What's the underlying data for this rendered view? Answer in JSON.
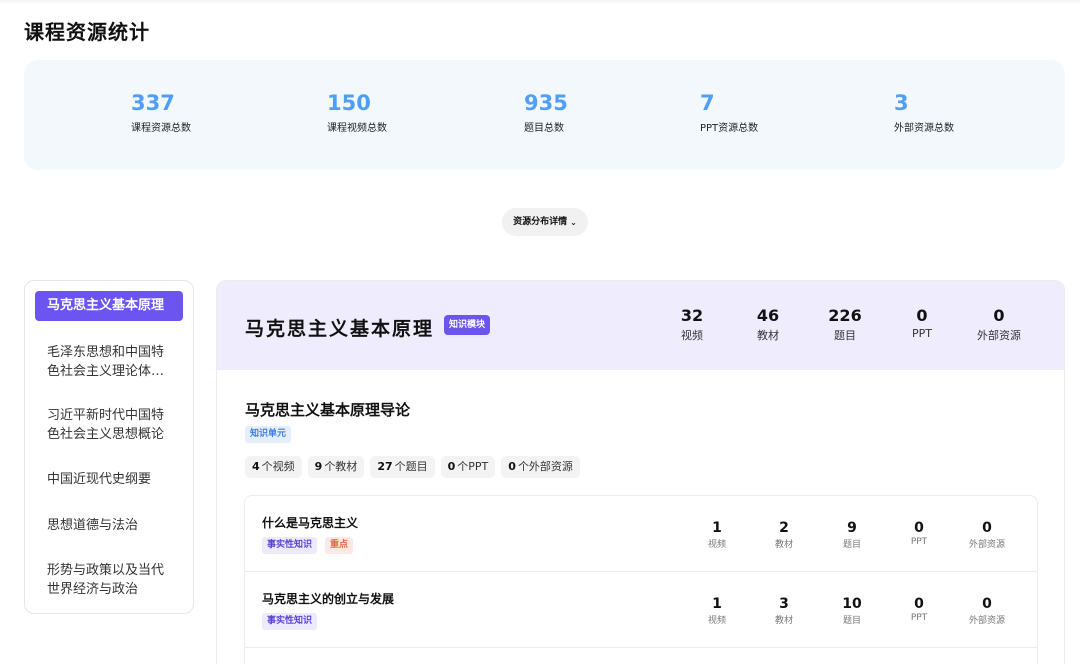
{
  "page_title": "课程资源统计",
  "summary_stats": [
    {
      "value": "337",
      "label": "课程资源总数"
    },
    {
      "value": "150",
      "label": "课程视频总数"
    },
    {
      "value": "935",
      "label": "题目总数"
    },
    {
      "value": "7",
      "label": "PPT资源总数"
    },
    {
      "value": "3",
      "label": "外部资源总数"
    }
  ],
  "dropdown": {
    "label": "资源分布详情",
    "chevron": "⌄"
  },
  "sidebar": {
    "items": [
      {
        "label": "马克思主义基本原理",
        "active": true
      },
      {
        "label": "毛泽东思想和中国特色社会主义理论体系概论"
      },
      {
        "label": "习近平新时代中国特色社会主义思想概论"
      },
      {
        "label": "中国近现代史纲要"
      },
      {
        "label": "思想道德与法治"
      },
      {
        "label": "形势与政策以及当代世界经济与政治"
      }
    ]
  },
  "module": {
    "title": "马克思主义基本原理",
    "tag": "知识模块",
    "stats": [
      {
        "value": "32",
        "label": "视频"
      },
      {
        "value": "46",
        "label": "教材"
      },
      {
        "value": "226",
        "label": "题目"
      },
      {
        "value": "0",
        "label": "PPT"
      },
      {
        "value": "0",
        "label": "外部资源"
      }
    ]
  },
  "unit": {
    "title": "马克思主义基本原理导论",
    "tag": "知识单元",
    "chips": [
      {
        "value": "4",
        "label": "个视频"
      },
      {
        "value": "9",
        "label": "个教材"
      },
      {
        "value": "27",
        "label": "个题目"
      },
      {
        "value": "0",
        "label": "个PPT"
      },
      {
        "value": "0",
        "label": "个外部资源"
      }
    ]
  },
  "items": [
    {
      "title": "什么是马克思主义",
      "tags": [
        "事实性知识",
        "重点"
      ],
      "stats": [
        {
          "value": "1",
          "label": "视频"
        },
        {
          "value": "2",
          "label": "教材"
        },
        {
          "value": "9",
          "label": "题目"
        },
        {
          "value": "0",
          "label": "PPT"
        },
        {
          "value": "0",
          "label": "外部资源"
        }
      ]
    },
    {
      "title": "马克思主义的创立与发展",
      "tags": [
        "事实性知识"
      ],
      "stats": [
        {
          "value": "1",
          "label": "视频"
        },
        {
          "value": "3",
          "label": "教材"
        },
        {
          "value": "10",
          "label": "题目"
        },
        {
          "value": "0",
          "label": "PPT"
        },
        {
          "value": "0",
          "label": "外部资源"
        }
      ]
    }
  ]
}
